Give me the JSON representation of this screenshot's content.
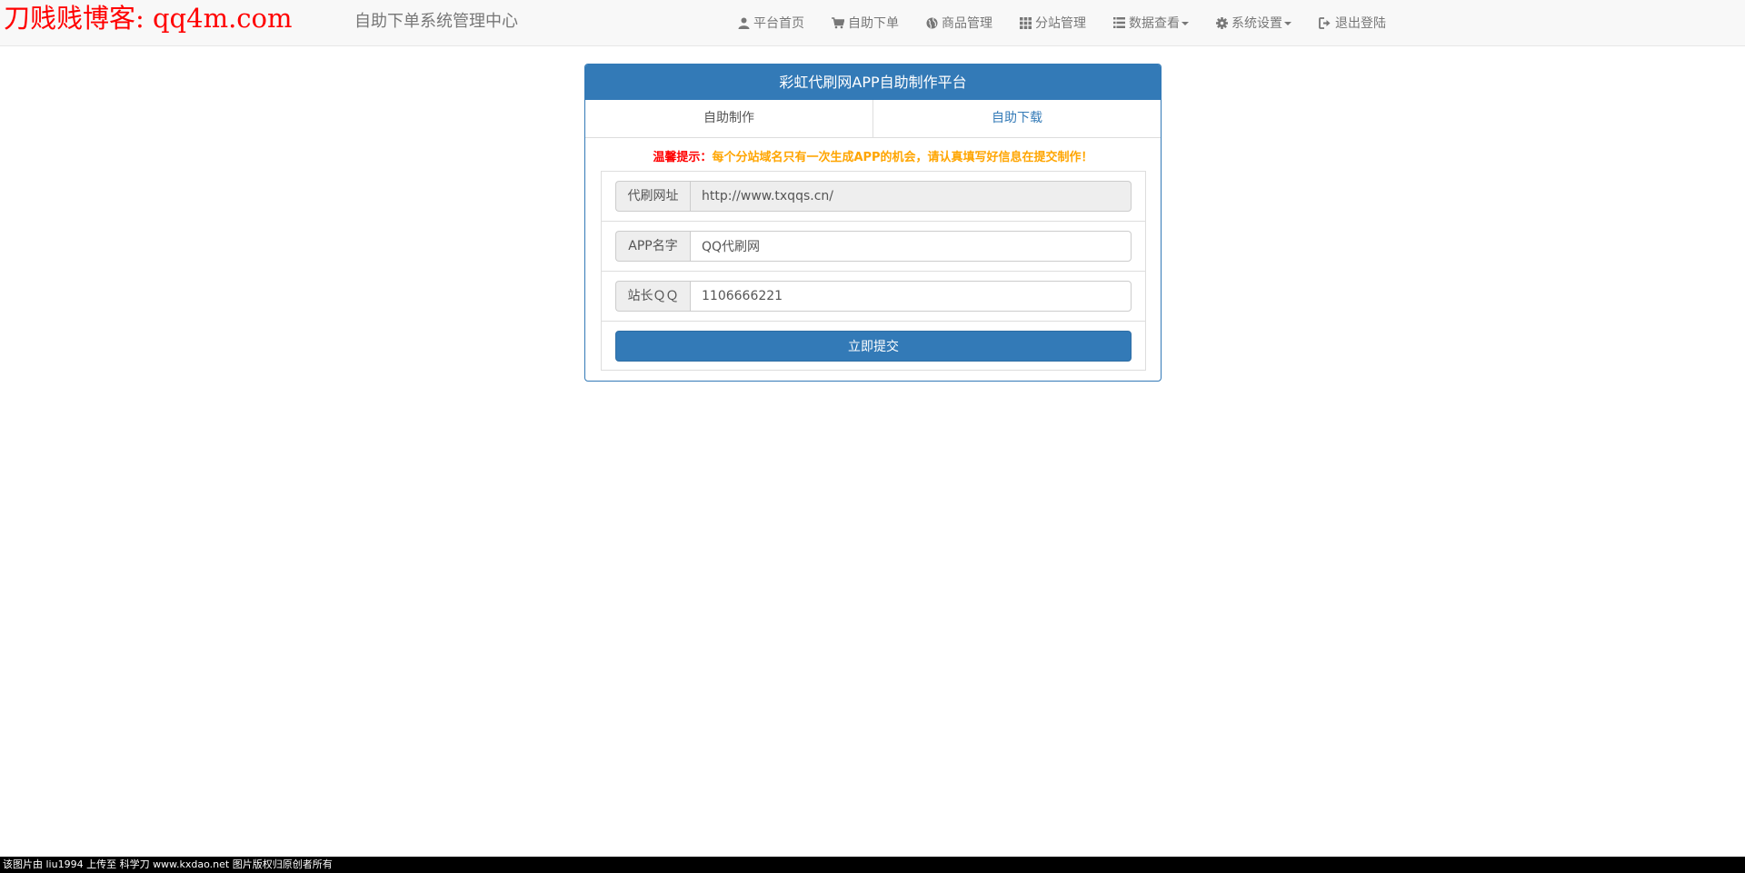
{
  "watermark": "刀贱贱博客: qq4m.com",
  "brand": "自助下单系统管理中心",
  "nav": [
    {
      "label": "平台首页",
      "icon": "user-icon"
    },
    {
      "label": "自助下单",
      "icon": "cart-icon"
    },
    {
      "label": "商品管理",
      "icon": "globe-icon"
    },
    {
      "label": "分站管理",
      "icon": "grid-icon"
    },
    {
      "label": "数据查看",
      "icon": "list-icon",
      "dropdown": true
    },
    {
      "label": "系统设置",
      "icon": "gear-icon",
      "dropdown": true
    },
    {
      "label": "退出登陆",
      "icon": "logout-icon"
    }
  ],
  "panel": {
    "title": "彩虹代刷网APP自助制作平台",
    "tabs": [
      {
        "label": "自助制作",
        "active": true
      },
      {
        "label": "自助下载",
        "active": false
      }
    ],
    "notice_label": "温馨提示：",
    "notice_text": "每个分站域名只有一次生成APP的机会，请认真填写好信息在提交制作！",
    "form": {
      "url_label": "代刷网址",
      "url_value": "http://www.txqqs.cn/",
      "appname_label": "APP名字",
      "appname_value": "QQ代刷网",
      "qq_label": "站长ＱＱ",
      "qq_value": "1106666221",
      "submit_label": "立即提交"
    }
  },
  "credit": "该图片由 liu1994 上传至 科学刀 www.kxdao.net 图片版权归原创者所有",
  "colors": {
    "primary": "#337ab7",
    "notice_label": "#ff0000",
    "notice_text": "#ffa500",
    "navbar_bg": "#f8f8f8"
  }
}
